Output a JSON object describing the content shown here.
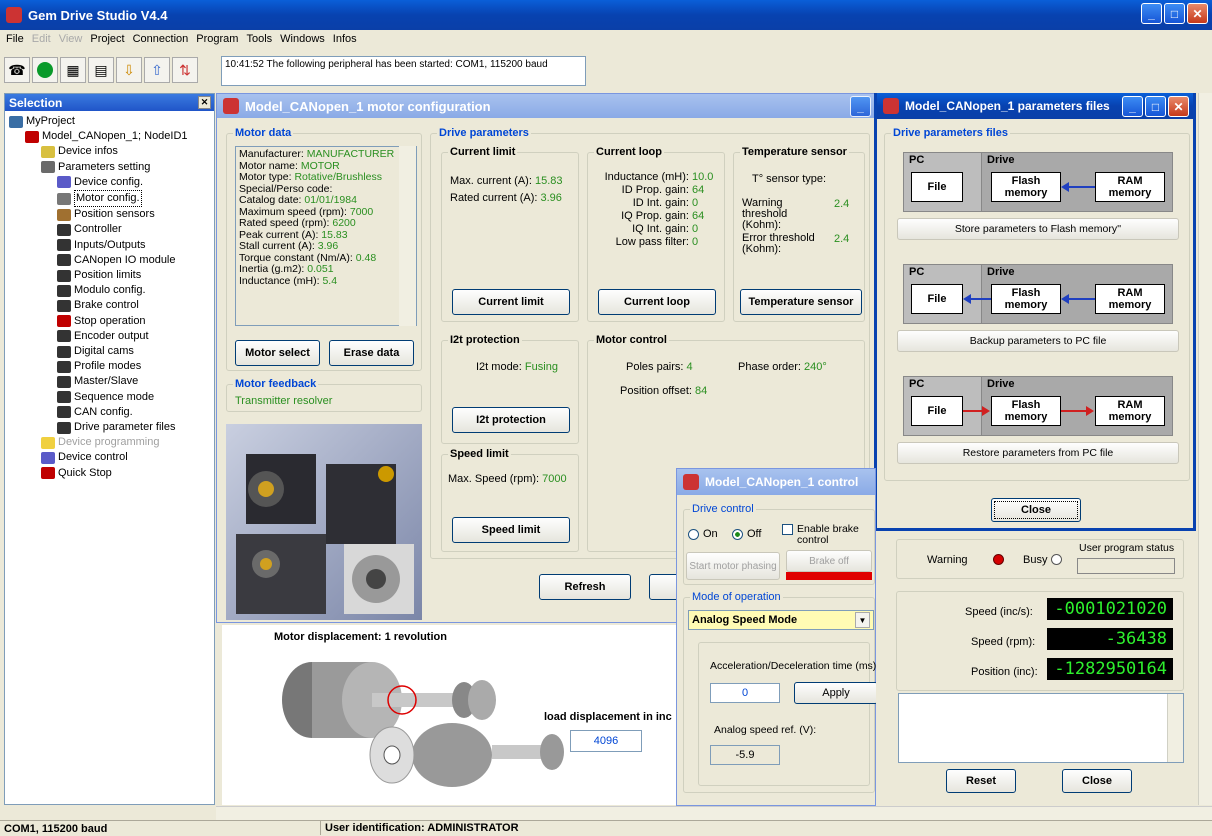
{
  "app": {
    "title": "Gem Drive Studio  V4.4"
  },
  "menu": [
    "File",
    "Edit",
    "View",
    "Project",
    "Connection",
    "Program",
    "Tools",
    "Windows",
    "Infos"
  ],
  "menu_disabled": [
    "Edit",
    "View"
  ],
  "message": "10:41:52 The following peripheral has been started: COM1, 115200 baud",
  "selection": {
    "title": "Selection",
    "tree": [
      {
        "label": "MyProject",
        "level": 0,
        "icon": "project-icon",
        "color": "#3a6ea5"
      },
      {
        "label": "Model_CANopen_1; NodeID1",
        "level": 1,
        "icon": "drive-icon",
        "color": "#c00000"
      },
      {
        "label": "Device infos",
        "level": 2,
        "icon": "info-icon",
        "color": "#d8c040"
      },
      {
        "label": "Parameters setting",
        "level": 2,
        "icon": "settings-icon",
        "color": "#6a6a6a"
      },
      {
        "label": "Device config.",
        "level": 3,
        "icon": "device-config-icon",
        "color": "#5a5ac8"
      },
      {
        "label": "Motor config.",
        "level": 3,
        "icon": "motor-config-icon",
        "color": "#777",
        "selected": true
      },
      {
        "label": "Position sensors",
        "level": 3,
        "icon": "sensor-icon",
        "color": "#a07030"
      },
      {
        "label": "Controller",
        "level": 3,
        "icon": "controller-icon",
        "color": "#333"
      },
      {
        "label": "Inputs/Outputs",
        "level": 3,
        "icon": "io-icon",
        "color": "#333"
      },
      {
        "label": "CANopen IO module",
        "level": 3,
        "icon": "can-io-icon",
        "color": "#333"
      },
      {
        "label": "Position limits",
        "level": 3,
        "icon": "limits-icon",
        "color": "#333"
      },
      {
        "label": "Modulo config.",
        "level": 3,
        "icon": "modulo-icon",
        "color": "#333"
      },
      {
        "label": "Brake control",
        "level": 3,
        "icon": "brake-icon",
        "color": "#333"
      },
      {
        "label": "Stop operation",
        "level": 3,
        "icon": "stop-pin-icon",
        "color": "#c00000"
      },
      {
        "label": "Encoder output",
        "level": 3,
        "icon": "encoder-icon",
        "color": "#333"
      },
      {
        "label": "Digital cams",
        "level": 3,
        "icon": "cams-icon",
        "color": "#333"
      },
      {
        "label": "Profile modes",
        "level": 3,
        "icon": "profile-icon",
        "color": "#333"
      },
      {
        "label": "Master/Slave",
        "level": 3,
        "icon": "master-slave-icon",
        "color": "#333"
      },
      {
        "label": "Sequence mode",
        "level": 3,
        "icon": "sequence-icon",
        "color": "#333"
      },
      {
        "label": "CAN config.",
        "level": 3,
        "icon": "can-icon",
        "color": "#333"
      },
      {
        "label": "Drive parameter files",
        "level": 3,
        "icon": "files-icon",
        "color": "#333"
      },
      {
        "label": "Device programming",
        "level": 2,
        "icon": "folder-icon",
        "color": "#f0d040",
        "disabled": true
      },
      {
        "label": "Device control",
        "level": 2,
        "icon": "device-control-icon",
        "color": "#5a5ac8"
      },
      {
        "label": "Quick Stop",
        "level": 2,
        "icon": "quick-stop-icon",
        "color": "#c00000"
      }
    ]
  },
  "motor_window": {
    "title": "Model_CANopen_1 motor configuration",
    "motor_data_label": "Motor data",
    "motor_data": [
      {
        "k": "Manufacturer: ",
        "v": "MANUFACTURER"
      },
      {
        "k": "Motor name: ",
        "v": "MOTOR"
      },
      {
        "k": "Motor type: ",
        "v": "Rotative/Brushless"
      },
      {
        "k": "Special/Perso code:",
        "v": ""
      },
      {
        "k": "Catalog date: ",
        "v": "01/01/1984"
      },
      {
        "k": "Maximum speed (rpm): ",
        "v": "7000"
      },
      {
        "k": "Rated speed (rpm): ",
        "v": "6200"
      },
      {
        "k": "Peak current (A): ",
        "v": "15.83"
      },
      {
        "k": "Stall current (A): ",
        "v": "3.96"
      },
      {
        "k": "Torque constant (Nm/A): ",
        "v": "0.48"
      },
      {
        "k": "Inertia (g.m2): ",
        "v": "0.051"
      },
      {
        "k": "Inductance (mH): ",
        "v": "5.4"
      }
    ],
    "motor_select": "Motor select",
    "erase_data": "Erase data",
    "motor_feedback_label": "Motor feedback",
    "motor_feedback_value": "Transmitter resolver",
    "drive_params_label": "Drive parameters",
    "current_limit": {
      "label": "Current limit",
      "max_k": "Max. current (A): ",
      "max_v": "15.83",
      "rated_k": "Rated current (A): ",
      "rated_v": "3.96",
      "button": "Current limit"
    },
    "current_loop": {
      "label": "Current loop",
      "rows": [
        {
          "k": "Inductance  (mH): ",
          "v": "10.0"
        },
        {
          "k": "ID Prop. gain: ",
          "v": "64"
        },
        {
          "k": "ID Int. gain: ",
          "v": "0"
        },
        {
          "k": "IQ Prop. gain: ",
          "v": "64"
        },
        {
          "k": "IQ Int. gain: ",
          "v": "0"
        },
        {
          "k": "Low pass filter: ",
          "v": "0"
        }
      ],
      "button": "Current loop"
    },
    "temp_sensor": {
      "label": "Temperature sensor",
      "type_k": "T° sensor type:",
      "warn_k": "Warning threshold (Kohm):",
      "warn_v": "2.4",
      "err_k": "Error threshold (Kohm):",
      "err_v": "2.4",
      "button": "Temperature sensor"
    },
    "i2t": {
      "label": "I2t protection",
      "mode_k": "I2t mode: ",
      "mode_v": "Fusing",
      "button": "I2t protection"
    },
    "motor_control": {
      "label": "Motor control",
      "poles_k": "Poles pairs: ",
      "poles_v": "4",
      "phase_k": "Phase order: ",
      "phase_v": "240°",
      "offset_k": "Position offset: ",
      "offset_v": "84"
    },
    "speed_limit": {
      "label": "Speed limit",
      "max_k": "Max. Speed (rpm): ",
      "max_v": "7000",
      "button": "Speed limit"
    },
    "refresh": "Refresh"
  },
  "displacement": {
    "motor_label": "Motor displacement: 1 revolution",
    "load_label": "load displacement in inc",
    "load_value": "4096"
  },
  "files_window": {
    "title": "Model_CANopen_1 parameters files",
    "group_label": "Drive parameters files",
    "pc": "PC",
    "drive": "Drive",
    "file": "File",
    "flash": "Flash memory",
    "ram": "RAM memory",
    "store": "Store parameters to Flash memory''",
    "backup": "Backup parameters to PC file",
    "restore": "Restore parameters from PC file",
    "close": "Close"
  },
  "control_window": {
    "title": "Model_CANopen_1 control",
    "drive_control_label": "Drive control",
    "on": "On",
    "off": "Off",
    "enable_brake": "Enable brake control",
    "start_phasing": "Start motor phasing",
    "brake_off": "Brake off",
    "mode_label": "Mode of operation",
    "mode_value": "Analog Speed Mode",
    "accel_label": "Acceleration/Deceleration time (ms):",
    "accel_value": "0",
    "apply": "Apply",
    "analog_label": "Analog speed ref. (V):",
    "analog_value": "-5.9",
    "warning": "Warning",
    "busy": "Busy",
    "user_program_status": "User program status",
    "speed_inc_k": "Speed (inc/s):",
    "speed_inc_v": "-0001021020",
    "speed_rpm_k": "Speed (rpm):",
    "speed_rpm_v": "-36438",
    "pos_k": "Position (inc):",
    "pos_v": "-1282950164",
    "reset": "Reset",
    "close": "Close",
    "colors": {
      "warning": "#d40000",
      "brake_bar": "#e00000"
    }
  },
  "status": {
    "left": "COM1, 115200 baud",
    "user": "User identification: ADMINISTRATOR"
  }
}
